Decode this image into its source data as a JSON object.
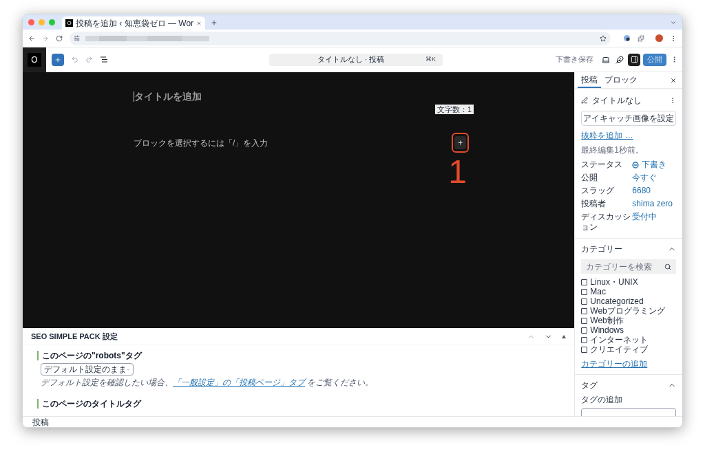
{
  "browser": {
    "tab": {
      "favicon": "O",
      "title": "投稿を追加 ‹ 知恵袋ゼロ — Wor",
      "selected": true
    }
  },
  "toolbar": {
    "logo": "O",
    "command_bar": {
      "title": "タイトルなし · 投稿",
      "shortcut": "⌘K"
    },
    "save_draft": "下書き保存",
    "publish": "公開",
    "sidebar_open": true
  },
  "editor": {
    "title_placeholder": "タイトルを追加",
    "word_count": "文字数：1",
    "block_placeholder": "ブロックを選択するには「/」を入力",
    "annotation": "1"
  },
  "sidebar": {
    "tabs": [
      {
        "label": "投稿",
        "selected": true
      },
      {
        "label": "ブロック",
        "selected": false
      }
    ],
    "post_title": "タイトルなし",
    "featured_image_button": "アイキャッチ画像を設定",
    "excerpt_link": "抜粋を追加 …",
    "last_edited": "最終編集1秒前。",
    "fields": [
      {
        "label": "ステータス",
        "value": "下書き",
        "kind": "status"
      },
      {
        "label": "公開",
        "value": "今すぐ",
        "kind": "link"
      },
      {
        "label": "スラッグ",
        "value": "6680",
        "kind": "link"
      },
      {
        "label": "投稿者",
        "value": "shima zero",
        "kind": "link"
      },
      {
        "label": "ディスカッション",
        "value": "受付中",
        "kind": "link"
      }
    ],
    "categories": {
      "title": "カテゴリー",
      "expanded": true,
      "search_placeholder": "カテゴリーを検索",
      "items": [
        {
          "label": "Linux・UNIX",
          "checked": false
        },
        {
          "label": "Mac",
          "checked": false
        },
        {
          "label": "Uncategorized",
          "checked": false
        },
        {
          "label": "Webプログラミング",
          "checked": false
        },
        {
          "label": "Web制作",
          "checked": false
        },
        {
          "label": "Windows",
          "checked": false
        },
        {
          "label": "インターネット",
          "checked": false
        },
        {
          "label": "クリエイティブ",
          "checked": false
        }
      ],
      "add_link": "カテゴリーの追加"
    },
    "tags": {
      "title": "タグ",
      "expanded": true,
      "input_label": "タグの追加"
    }
  },
  "seo_panel": {
    "title": "SEO SIMPLE PACK 設定",
    "robots_heading": "このページの\"robots\"タグ",
    "robots_select": "デフォルト設定のまま",
    "help_before": "デフォルト設定を確認したい場合、",
    "help_link": "「一般設定」の「投稿ページ」タブ",
    "help_after": " をご覧ください。",
    "title_heading": "このページのタイトルタグ"
  },
  "status_bar": "投稿"
}
